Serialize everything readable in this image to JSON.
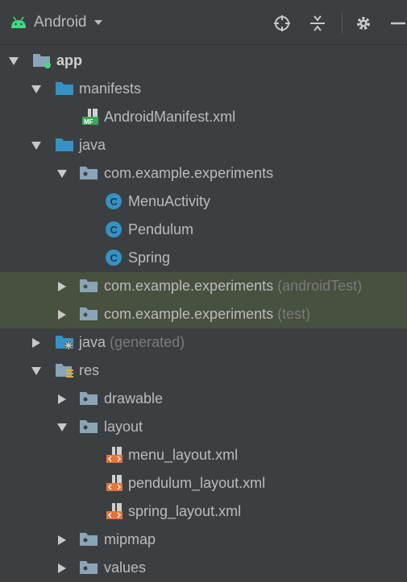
{
  "toolbar": {
    "view_label": "Android",
    "icons": [
      "android-icon",
      "dropdown-arrow-icon",
      "crosshair-icon",
      "collapse-all-icon",
      "gear-icon",
      "minimize-icon"
    ]
  },
  "tree": {
    "app": "app",
    "manifests": "manifests",
    "android_manifest": "AndroidManifest.xml",
    "java": "java",
    "pkg_main": "com.example.experiments",
    "class_menu": "MenuActivity",
    "class_pendulum": "Pendulum",
    "class_spring": "Spring",
    "pkg_android_test": "com.example.experiments",
    "pkg_android_test_suffix": "(androidTest)",
    "pkg_test": "com.example.experiments",
    "pkg_test_suffix": "(test)",
    "java_generated": "java",
    "java_generated_suffix": "(generated)",
    "res": "res",
    "drawable": "drawable",
    "layout": "layout",
    "menu_layout": "menu_layout.xml",
    "pendulum_layout": "pendulum_layout.xml",
    "spring_layout": "spring_layout.xml",
    "mipmap": "mipmap",
    "values": "values"
  },
  "colors": {
    "background": "#3c3f41",
    "highlight_row": "#48503f",
    "folder_blue": "#3592c4",
    "class_blue": "#3592c4",
    "android_green": "#3ddc84",
    "xml_orange": "#e8733a"
  }
}
